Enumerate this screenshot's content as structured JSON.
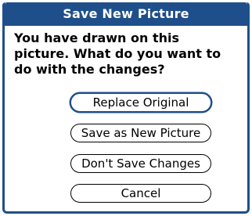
{
  "dialog": {
    "title": "Save New Picture",
    "message_lines": [
      "You have drawn on this",
      "picture. What do you want to",
      "do with the changes?"
    ]
  },
  "buttons": [
    {
      "label": "Replace Original",
      "selected": true
    },
    {
      "label": "Save as New Picture",
      "selected": false
    },
    {
      "label": "Don't Save Changes",
      "selected": false
    },
    {
      "label": "Cancel",
      "selected": false
    }
  ],
  "colors": {
    "accent": "#1f4f8a",
    "background": "#ffffff",
    "text": "#000000"
  }
}
